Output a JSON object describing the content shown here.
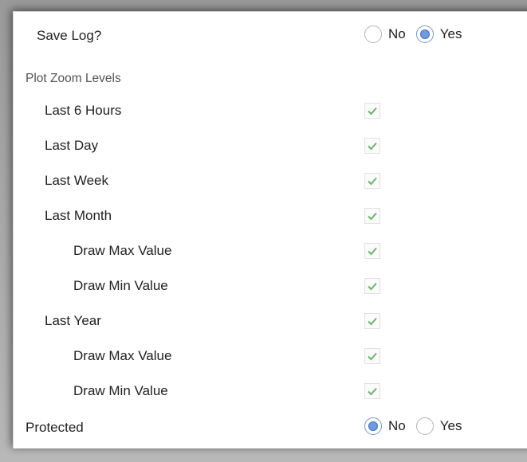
{
  "save_log": {
    "label": "Save Log?",
    "options": [
      {
        "label": "No",
        "selected": false
      },
      {
        "label": "Yes",
        "selected": true
      }
    ]
  },
  "plot_zoom": {
    "section_label": "Plot Zoom Levels",
    "items": [
      {
        "label": "Last 6 Hours",
        "checked": true
      },
      {
        "label": "Last Day",
        "checked": true
      },
      {
        "label": "Last Week",
        "checked": true
      },
      {
        "label": "Last Month",
        "checked": true
      },
      {
        "label": "Draw Max Value",
        "checked": true
      },
      {
        "label": "Draw Min Value",
        "checked": true
      },
      {
        "label": "Last Year",
        "checked": true
      },
      {
        "label": "Draw Max Value",
        "checked": true
      },
      {
        "label": "Draw Min Value",
        "checked": true
      }
    ]
  },
  "protected": {
    "label": "Protected",
    "options": [
      {
        "label": "No",
        "selected": true
      },
      {
        "label": "Yes",
        "selected": false
      }
    ]
  },
  "colors": {
    "check": "#6db36d",
    "radio_selected": "#6f9ae0"
  }
}
